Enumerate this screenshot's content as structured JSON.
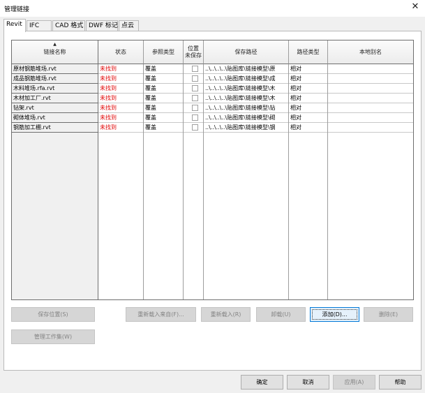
{
  "window": {
    "title": "管理链接",
    "close_glyph": "✕"
  },
  "tabs": [
    {
      "label": "Revit",
      "active": true
    },
    {
      "label": "IFC",
      "active": false
    },
    {
      "label": "CAD 格式",
      "active": false
    },
    {
      "label": "DWF 标记",
      "active": false
    },
    {
      "label": "点云",
      "active": false
    }
  ],
  "table": {
    "sort_glyph": "▲",
    "columns": {
      "name": "链接名称",
      "status": "状态",
      "ref_type": "参照类型",
      "pos_line1": "位置",
      "pos_line2": "未保存",
      "path": "保存路径",
      "path_type": "路径类型",
      "alias": "本地别名"
    },
    "rows": [
      {
        "name": "原材钢筋堆场.rvt",
        "status": "未找到",
        "ref_type": "覆盖",
        "path": "..\\..\\..\\..\\贴图库\\链接模型\\原",
        "path_type": "相对",
        "alias": ""
      },
      {
        "name": "成品钢筋堆场.rvt",
        "status": "未找到",
        "ref_type": "覆盖",
        "path": "..\\..\\..\\..\\贴图库\\链接模型\\成",
        "path_type": "相对",
        "alias": ""
      },
      {
        "name": "木料堆场.rfa.rvt",
        "status": "未找到",
        "ref_type": "覆盖",
        "path": "..\\..\\..\\..\\贴图库\\链接模型\\木",
        "path_type": "相对",
        "alias": ""
      },
      {
        "name": "木材加工厂.rvt",
        "status": "未找到",
        "ref_type": "覆盖",
        "path": "..\\..\\..\\..\\贴图库\\链接模型\\木",
        "path_type": "相对",
        "alias": ""
      },
      {
        "name": "钻架.rvt",
        "status": "未找到",
        "ref_type": "覆盖",
        "path": "..\\..\\..\\..\\贴图库\\链接模型\\钻",
        "path_type": "相对",
        "alias": ""
      },
      {
        "name": "砌体堆场.rvt",
        "status": "未找到",
        "ref_type": "覆盖",
        "path": "..\\..\\..\\..\\贴图库\\链接模型\\砌",
        "path_type": "相对",
        "alias": ""
      },
      {
        "name": "钢筋加工棚.rvt",
        "status": "未找到",
        "ref_type": "覆盖",
        "path": "..\\..\\..\\..\\贴图库\\链接模型\\钢",
        "path_type": "相对",
        "alias": ""
      }
    ]
  },
  "buttons": {
    "save_position": "保存位置(S)",
    "reload_from": "重新载入来自(F)...",
    "reload": "重新载入(R)",
    "unload": "卸载(U)",
    "add": "添加(D)...",
    "remove": "删除(E)",
    "manage_worksets": "管理工作集(W)",
    "ok": "确定",
    "cancel": "取消",
    "apply": "应用(A)",
    "help": "帮助"
  }
}
